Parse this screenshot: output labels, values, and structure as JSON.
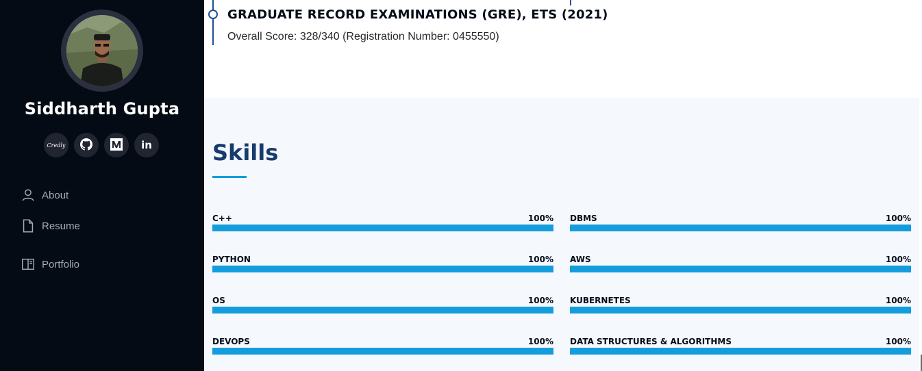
{
  "profile": {
    "name": "Siddharth Gupta",
    "social": [
      {
        "icon": "credly-icon",
        "label": "Credly"
      },
      {
        "icon": "github-icon",
        "label": ""
      },
      {
        "icon": "medium-icon",
        "label": ""
      },
      {
        "icon": "linkedin-icon",
        "label": "in"
      }
    ]
  },
  "nav": [
    {
      "icon": "person-icon",
      "label": "About"
    },
    {
      "icon": "file-icon",
      "label": "Resume"
    },
    {
      "icon": "book-icon",
      "label": "Portfolio"
    }
  ],
  "resume": {
    "gre_title": "GRADUATE RECORD EXAMINATIONS (GRE), ETS (2021)",
    "gre_score": "Overall Score: 328/340 (Registration Number: 0455550)"
  },
  "skills": {
    "title": "Skills",
    "items": [
      {
        "name": "C++",
        "value": "100%",
        "level": 100
      },
      {
        "name": "DBMS",
        "value": "100%",
        "level": 100
      },
      {
        "name": "PYTHON",
        "value": "100%",
        "level": 100
      },
      {
        "name": "AWS",
        "value": "100%",
        "level": 100
      },
      {
        "name": "OS",
        "value": "100%",
        "level": 100
      },
      {
        "name": "KUBERNETES",
        "value": "100%",
        "level": 100
      },
      {
        "name": "DEVOPS",
        "value": "100%",
        "level": 100
      },
      {
        "name": "DATA STRUCTURES & ALGORITHMS",
        "value": "100%",
        "level": 100
      }
    ]
  },
  "colors": {
    "sidebar_bg": "#040b14",
    "accent": "#149ddd",
    "heading": "#173b6c"
  }
}
